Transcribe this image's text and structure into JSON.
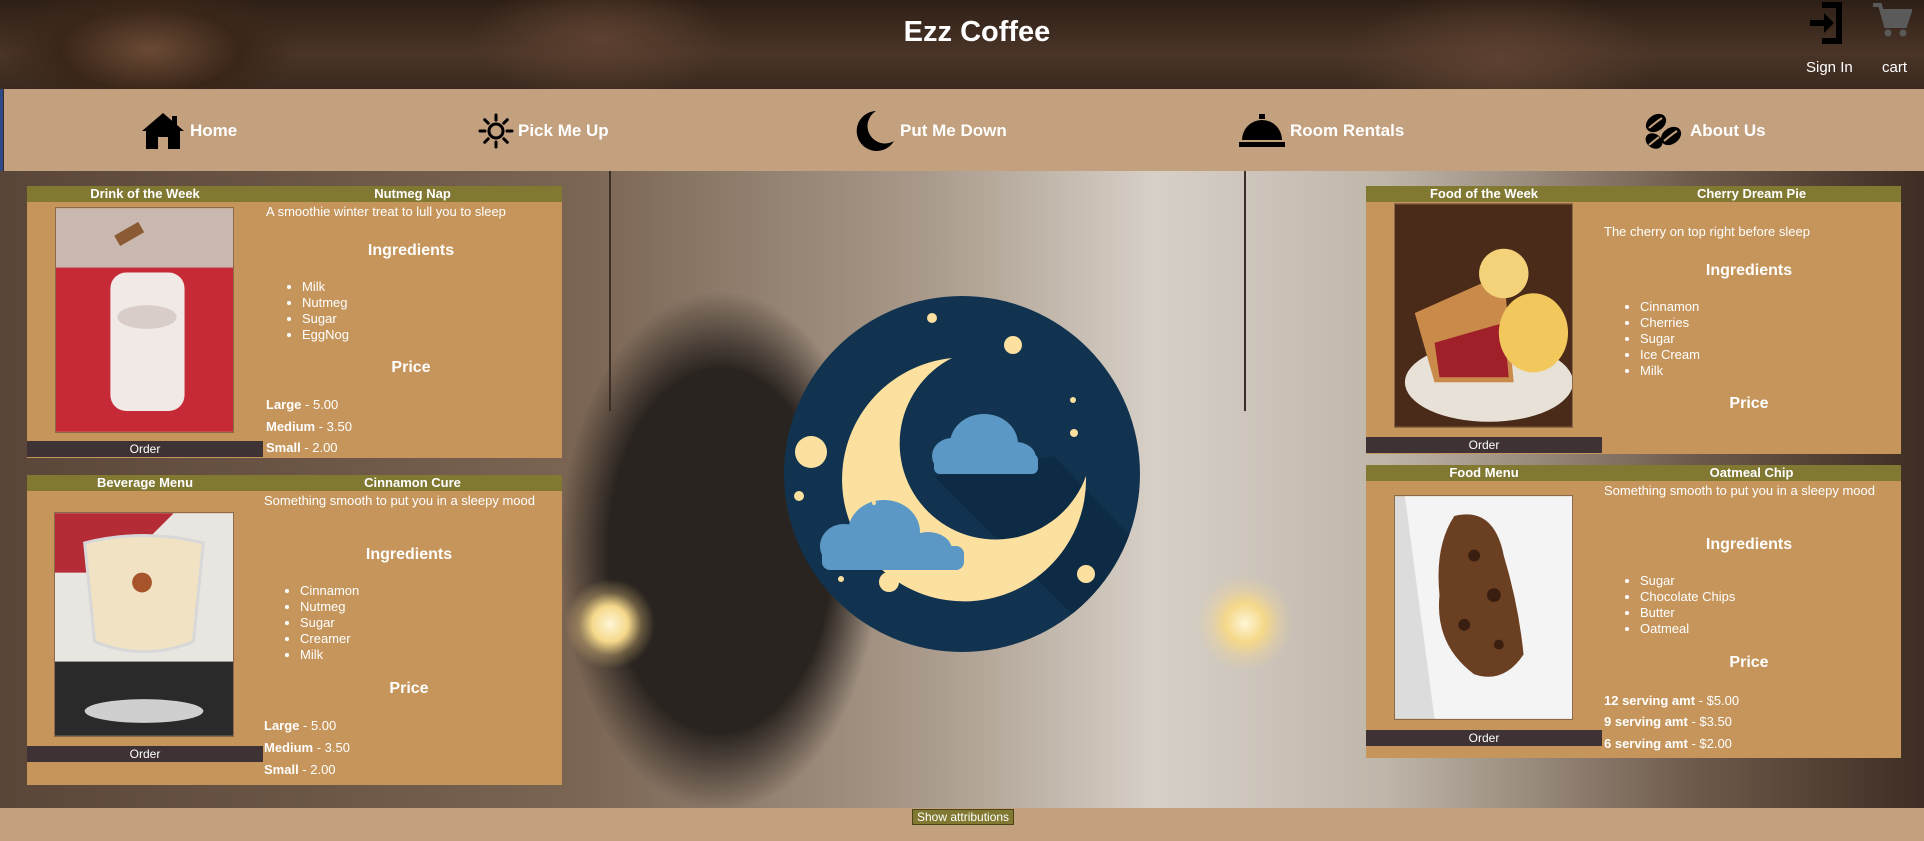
{
  "header": {
    "title": "Ezz Coffee",
    "sign_in": "Sign In",
    "cart": "cart"
  },
  "nav": [
    {
      "label": "Home",
      "icon": "home-icon"
    },
    {
      "label": "Pick Me Up",
      "icon": "sun-icon"
    },
    {
      "label": "Put Me Down",
      "icon": "moon-icon"
    },
    {
      "label": "Room Rentals",
      "icon": "service-bell-icon"
    },
    {
      "label": "About Us",
      "icon": "coffee-beans-icon"
    }
  ],
  "cards": {
    "drink_week": {
      "section": "Drink of the Week",
      "name": "Nutmeg Nap",
      "description": "A smoothie winter treat to lull you to sleep",
      "ingredients_heading": "Ingredients",
      "ingredients": [
        "Milk",
        "Nutmeg",
        "Sugar",
        "EggNog"
      ],
      "price_heading": "Price",
      "prices": [
        {
          "size": "Large",
          "price": " - 5.00"
        },
        {
          "size": "Medium",
          "price": " - 3.50"
        },
        {
          "size": "Small",
          "price": " - 2.00"
        }
      ],
      "order": "Order"
    },
    "beverage_menu": {
      "section": "Beverage Menu",
      "name": "Cinnamon Cure",
      "description": "Something smooth to put you in a sleepy mood",
      "ingredients_heading": "Ingredients",
      "ingredients": [
        "Cinnamon",
        "Nutmeg",
        "Sugar",
        "Creamer",
        "Milk"
      ],
      "price_heading": "Price",
      "prices": [
        {
          "size": "Large",
          "price": " - 5.00"
        },
        {
          "size": "Medium",
          "price": " - 3.50"
        },
        {
          "size": "Small",
          "price": " - 2.00"
        }
      ],
      "order": "Order"
    },
    "food_week": {
      "section": "Food of the Week",
      "name": "Cherry Dream Pie",
      "description": "The cherry on top right before sleep",
      "ingredients_heading": "Ingredients",
      "ingredients": [
        "Cinnamon",
        "Cherries",
        "Sugar",
        "Ice Cream",
        "Milk"
      ],
      "price_heading": "Price",
      "order": "Order"
    },
    "food_menu": {
      "section": "Food Menu",
      "name": "Oatmeal Chip",
      "description": "Something smooth to put you in a sleepy mood",
      "ingredients_heading": "Ingredients",
      "ingredients": [
        "Sugar",
        "Chocolate Chips",
        "Butter",
        "Oatmeal"
      ],
      "price_heading": "Price",
      "prices": [
        {
          "size": "12 serving amt",
          "price": " - $5.00"
        },
        {
          "size": "9 serving amt",
          "price": " - $3.50"
        },
        {
          "size": "6 serving amt",
          "price": " - $2.00"
        }
      ],
      "order": "Order"
    }
  },
  "footer": {
    "attributions": "Show attributions"
  },
  "colors": {
    "nav_bg": "#c3a07e",
    "panel_bg": "#c5955b",
    "panel_header": "#817832",
    "order_bg": "#3e3234",
    "moon_bg": "#11334f",
    "moon": "#fbe0a0",
    "cloud": "#5b98c5"
  }
}
